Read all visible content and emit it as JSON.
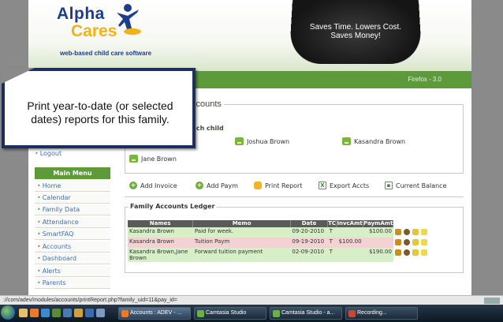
{
  "header": {
    "logo_alpha": "Alpha",
    "logo_cares": "Cares",
    "logo_tagline": "web-based child care software",
    "slogan": "Saves Time. Lowers Cost. Saves Money!",
    "firefox_label": "Firefox - 3.0"
  },
  "callout": {
    "text": "Print year-to-date (or selected dates) reports for this family."
  },
  "sidebar": {
    "logout": "Logout",
    "main_menu": "Main Menu",
    "items": [
      "Home",
      "Calendar",
      "Family Data",
      "Attendance",
      "SmartFAQ",
      "Accounts",
      "Dashboard",
      "Alerts",
      "Parents"
    ]
  },
  "accounts": {
    "title_fragment": "ccounts",
    "each_child": "each child",
    "children": [
      "Joshua Brown",
      "Kasandra Brown",
      "Jane Brown"
    ]
  },
  "actions": [
    "Add Invoice",
    "Add Paym",
    "Print Report",
    "Export Accts",
    "Current Balance"
  ],
  "ledger": {
    "title": "Family Accounts Ledger",
    "columns": [
      "Names",
      "Memo",
      "Date",
      "TC",
      "InvcAmt",
      "PaymAmt"
    ],
    "rows": [
      {
        "names": "Kasandra Brown",
        "memo": "Paid for week.",
        "date": "09-20-2010",
        "tc": "T",
        "invc": "",
        "paym": "$100.00",
        "tint": "green"
      },
      {
        "names": "Kasandra Brown",
        "memo": "Tuition Paym",
        "date": "09-19-2010",
        "tc": "T",
        "invc": "$100.00",
        "paym": "",
        "tint": "pink"
      },
      {
        "names": "Kasandra Brown,Jane Brown",
        "memo": "Forward tuition payment",
        "date": "02-09-2010",
        "tc": "T",
        "invc": "",
        "paym": "$190.00",
        "tint": "green"
      }
    ]
  },
  "statusbar": {
    "url": "://com/adev/modules/accounts/printReport.php?family_uid=11&pay_id="
  },
  "taskbar": {
    "tasks": [
      "Accounts : ADEV - ...",
      "Camtasia Studio",
      "Camtasia Studio - a...",
      "Recording..."
    ]
  },
  "colors": {
    "brand_green": "#5d9a3a",
    "brand_blue": "#1c3d8c",
    "brand_yellow": "#f2b21a",
    "row_green": "#d6efc6",
    "row_pink": "#f4d2d4"
  }
}
